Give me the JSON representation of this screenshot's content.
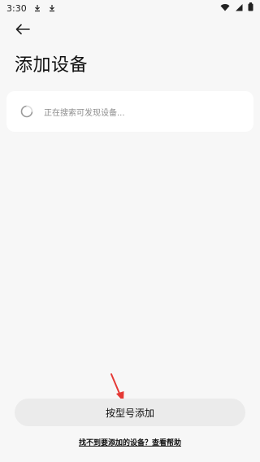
{
  "status_bar": {
    "time": "3:30",
    "icons": [
      "download-icon",
      "download-icon",
      "wifi-icon",
      "signal-icon",
      "battery-icon"
    ]
  },
  "header": {
    "back_icon": "back-arrow-icon",
    "title": "添加设备"
  },
  "search_card": {
    "icon": "loading-spinner-icon",
    "status_text": "正在搜索可发现设备..."
  },
  "actions": {
    "add_by_model_label": "按型号添加",
    "help_link_text": "找不到要添加的设备？查看帮助"
  },
  "colors": {
    "background": "#f7f7f7",
    "card": "#ffffff",
    "button": "#ebebeb",
    "annotation_arrow": "#e53935"
  }
}
